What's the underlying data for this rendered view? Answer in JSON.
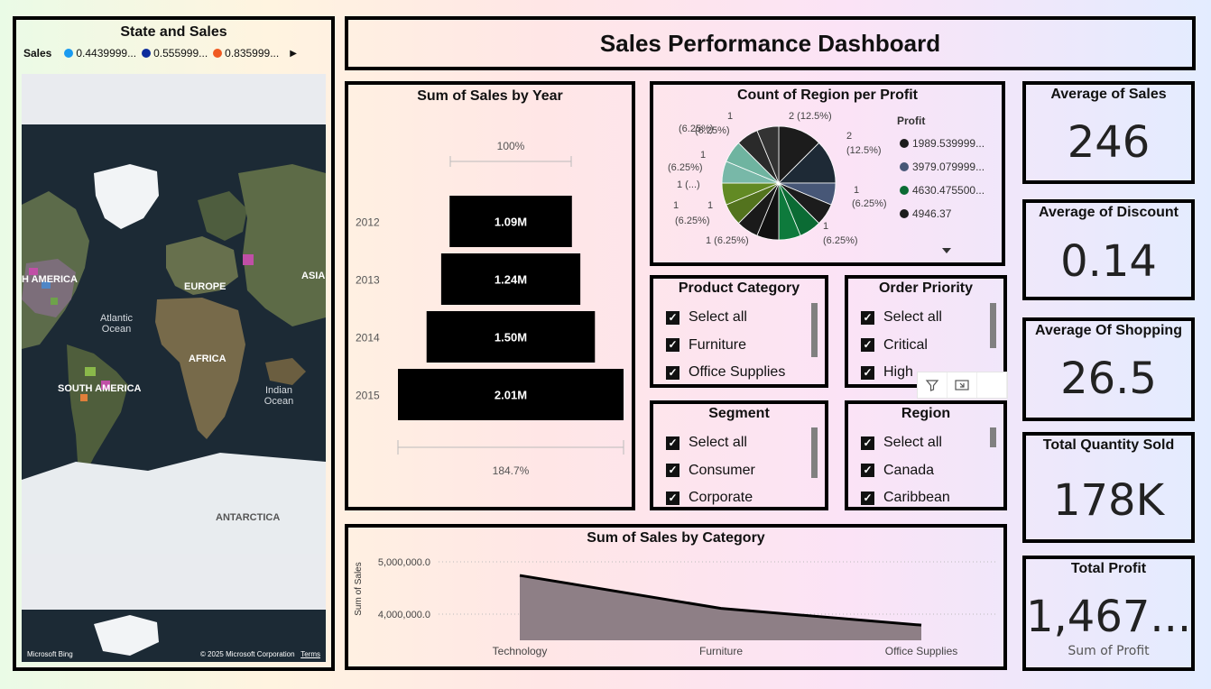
{
  "header": {
    "title": "Sales Performance Dashboard"
  },
  "map": {
    "title": "State and Sales",
    "legend_label": "Sales",
    "legend_items": [
      {
        "label": "0.4439999...",
        "color": "#1a9bf0"
      },
      {
        "label": "0.555999...",
        "color": "#0d2c9c"
      },
      {
        "label": "0.835999...",
        "color": "#f05a22"
      }
    ],
    "labels": {
      "north_america": "H AMERICA",
      "europe": "EUROPE",
      "asia": "ASIA",
      "atlantic": "Atlantic Ocean",
      "africa": "AFRICA",
      "south_america": "SOUTH AMERICA",
      "indian": "Indian Ocean",
      "antarctica": "ANTARCTICA"
    },
    "footer_brand": "Microsoft Bing",
    "footer_copyright": "© 2025 Microsoft Corporation",
    "footer_terms": "Terms"
  },
  "funnel": {
    "title": "Sum of Sales by Year",
    "top_percent": "100%",
    "bottom_percent": "184.7%"
  },
  "pie": {
    "title": "Count of Region per Profit",
    "legend_title": "Profit",
    "legend_items": [
      {
        "label": "1989.539999...",
        "color": "#1c1c1c"
      },
      {
        "label": "3979.079999...",
        "color": "#475777"
      },
      {
        "label": "4630.475500...",
        "color": "#0b6b34"
      },
      {
        "label": "4946.37",
        "color": "#1c1c1c"
      }
    ],
    "labels": [
      "2 (12.5%)",
      "2",
      "(12.5%)",
      "1",
      "(6.25%)",
      "1",
      "(6.25%)",
      "1 (6.25%)",
      "1",
      "(6.25%)",
      "1",
      "1 (...)",
      "(6.25%)",
      "1",
      "(6.25%)",
      "1",
      "(6.25%)"
    ]
  },
  "slicers": {
    "category": {
      "title": "Product Category",
      "items": [
        "Select all",
        "Furniture",
        "Office Supplies"
      ]
    },
    "priority": {
      "title": "Order Priority",
      "items": [
        "Select all",
        "Critical",
        "High"
      ]
    },
    "segment": {
      "title": "Segment",
      "items": [
        "Select all",
        "Consumer",
        "Corporate"
      ]
    },
    "region": {
      "title": "Region",
      "items": [
        "Select all",
        "Canada",
        "Caribbean"
      ]
    }
  },
  "area": {
    "title": "Sum of Sales by Category"
  },
  "kpis": {
    "sales": {
      "title": "Average of Sales",
      "value": "246"
    },
    "discount": {
      "title": "Average of Discount",
      "value": "0.14"
    },
    "shipping": {
      "title": "Average Of Shopping",
      "value": "26.5"
    },
    "quantity": {
      "title": "Total Quantity Sold",
      "value": "178K"
    },
    "profit": {
      "title": "Total Profit",
      "value": "1,467...",
      "subtitle": "Sum of Profit"
    }
  },
  "chart_data": [
    {
      "type": "bar",
      "title": "Sum of Sales by Year",
      "orientation": "funnel",
      "categories": [
        "2012",
        "2013",
        "2014",
        "2015"
      ],
      "values": [
        1.09,
        1.24,
        1.5,
        2.01
      ],
      "value_labels": [
        "1.09M",
        "1.24M",
        "1.50M",
        "2.01M"
      ],
      "bar_color": "#000000"
    },
    {
      "type": "pie",
      "title": "Count of Region per Profit",
      "slices": [
        {
          "value": 2,
          "color": "#1c1c1c"
        },
        {
          "value": 2,
          "color": "#1e2a36"
        },
        {
          "value": 1,
          "color": "#475777"
        },
        {
          "value": 1,
          "color": "#1c1c1c"
        },
        {
          "value": 1,
          "color": "#0b6b34"
        },
        {
          "value": 1,
          "color": "#0e7a3c"
        },
        {
          "value": 1,
          "color": "#111111"
        },
        {
          "value": 1,
          "color": "#1a1a1a"
        },
        {
          "value": 1,
          "color": "#53731e"
        },
        {
          "value": 1,
          "color": "#628a24"
        },
        {
          "value": 1,
          "color": "#78b8a8"
        },
        {
          "value": 1,
          "color": "#6fb4a0"
        },
        {
          "value": 1,
          "color": "#2a2a2a"
        },
        {
          "value": 1,
          "color": "#333333"
        }
      ]
    },
    {
      "type": "area",
      "title": "Sum of Sales by Category",
      "categories": [
        "Technology",
        "Furniture",
        "Office Supplies"
      ],
      "values": [
        4740000,
        4110000,
        3790000
      ],
      "ylabel": "Sum of Sales",
      "yticks": [
        "5,000,000.0",
        "4,000,000.0"
      ],
      "ylim": [
        3500000,
        5000000
      ],
      "fill_color": "#8e7f86",
      "line_color": "#000000"
    }
  ]
}
